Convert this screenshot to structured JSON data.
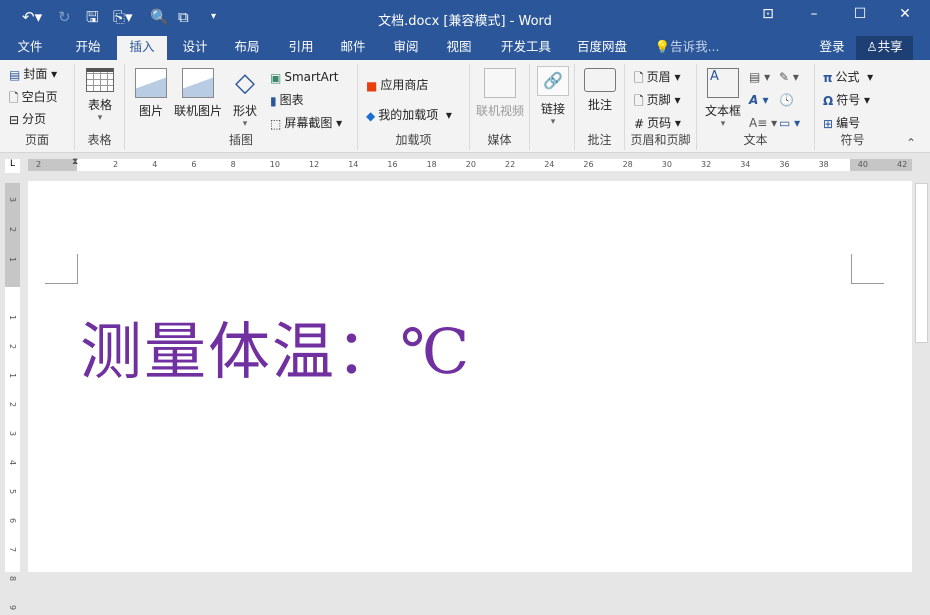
{
  "title": "文档.docx [兼容模式] - Word",
  "tabs": [
    "文件",
    "开始",
    "插入",
    "设计",
    "布局",
    "引用",
    "邮件",
    "审阅",
    "视图",
    "开发工具",
    "百度网盘"
  ],
  "active_tab": "插入",
  "tell_me": "告诉我...",
  "login": "登录",
  "share": "共享",
  "groups": {
    "pages": {
      "label": "页面",
      "items": [
        "封面",
        "空白页",
        "分页"
      ]
    },
    "tables": {
      "label": "表格",
      "items": [
        "表格"
      ]
    },
    "illustrations": {
      "label": "插图",
      "items": [
        "图片",
        "联机图片",
        "形状",
        "SmartArt",
        "图表",
        "屏幕截图"
      ]
    },
    "addins": {
      "label": "加载项",
      "items": [
        "应用商店",
        "我的加载项"
      ]
    },
    "media": {
      "label": "媒体",
      "items": [
        "联机视频"
      ]
    },
    "links": {
      "label": "",
      "items": [
        "链接"
      ]
    },
    "comments": {
      "label": "批注",
      "items": [
        "批注"
      ]
    },
    "header_footer": {
      "label": "页眉和页脚",
      "items": [
        "页眉",
        "页脚",
        "页码"
      ]
    },
    "text": {
      "label": "文本",
      "items": [
        "文本框"
      ]
    },
    "symbols": {
      "label": "符号",
      "items": [
        "公式",
        "符号",
        "编号"
      ]
    }
  },
  "ruler_h": [
    "2",
    "2",
    "4",
    "6",
    "8",
    "10",
    "12",
    "14",
    "16",
    "18",
    "20",
    "22",
    "24",
    "26",
    "28",
    "30",
    "32",
    "34",
    "36",
    "38",
    "40",
    "42"
  ],
  "ruler_v": [
    "3",
    "2",
    "1",
    "1",
    "2",
    "1",
    "2",
    "3",
    "4",
    "5",
    "6",
    "7",
    "8",
    "9"
  ],
  "document": {
    "text": "测量体温：℃"
  },
  "colors": {
    "brand": "#2b579a",
    "text": "#7030a0"
  }
}
